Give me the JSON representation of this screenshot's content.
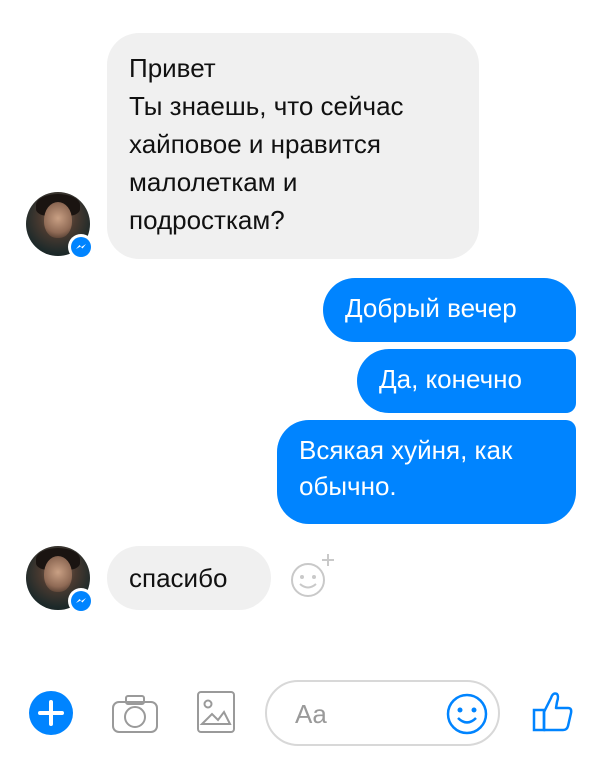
{
  "messages": {
    "incoming_1": {
      "lines": [
        "Привет",
        "Ты знаешь, что сейчас",
        "хайповое и нравится",
        "малолеткам и",
        "подросткам?"
      ]
    },
    "outgoing": [
      {
        "lines": [
          "Добрый вечер"
        ]
      },
      {
        "lines": [
          "Да, конечно"
        ]
      },
      {
        "lines": [
          "Всякая хуйня, как",
          "обычно."
        ]
      }
    ],
    "incoming_2": {
      "text": "спасибо"
    }
  },
  "composer": {
    "placeholder": "Aa"
  },
  "colors": {
    "outgoing_bubble": "#0084ff",
    "incoming_bubble": "#f0f0f0",
    "accent": "#0084ff"
  },
  "icons": [
    "messenger-badge-icon",
    "add-reaction-icon",
    "plus-icon",
    "camera-icon",
    "image-icon",
    "emoji-icon",
    "thumbs-up-icon"
  ]
}
